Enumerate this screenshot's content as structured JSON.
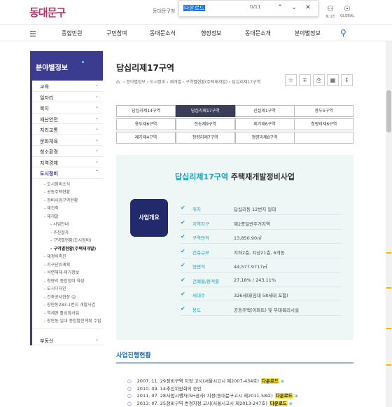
{
  "header": {
    "logo_text": "동대문구",
    "sub_text": "동대문구청",
    "login_label": "로그인",
    "global_label": "GLOBAL"
  },
  "find_bar": {
    "query": "다운로드",
    "count": "0/11"
  },
  "nav": {
    "items": [
      "종합민원",
      "구민참여",
      "동대문소식",
      "행정정보",
      "동대문소개",
      "분야별정보"
    ]
  },
  "sidebar": {
    "title": "분야별정보",
    "items": [
      {
        "label": "교육",
        "chev": "⌄"
      },
      {
        "label": "일자리",
        "chev": "⌄"
      },
      {
        "label": "복지",
        "chev": "⌄"
      },
      {
        "label": "재난안전",
        "chev": "⌄"
      },
      {
        "label": "지리교통",
        "chev": "⌄"
      },
      {
        "label": "문화체육",
        "chev": "⌄"
      },
      {
        "label": "청소환경",
        "chev": "⌄"
      },
      {
        "label": "지역경제",
        "chev": "⌄"
      },
      {
        "label": "도시정비",
        "chev": "⌃"
      }
    ],
    "sub_items": [
      {
        "label": "- 도시정비소식",
        "kind": ""
      },
      {
        "label": "- 공동주택현황",
        "kind": ""
      },
      {
        "label": "- 정비사업구역현황",
        "kind": ""
      },
      {
        "label": "- 재건축",
        "kind": ""
      },
      {
        "label": "- 재개발",
        "kind": ""
      },
      {
        "label": "- 사업안내",
        "kind": "deep"
      },
      {
        "label": "- 추진절차",
        "kind": "deep"
      },
      {
        "label": "- 구역별현황(도시정비)",
        "kind": "deep"
      },
      {
        "label": "- 구역별현황(주택재개발)",
        "kind": "deep cur"
      },
      {
        "label": "- 재정비촉진",
        "kind": ""
      },
      {
        "label": "- 지구단위계획",
        "kind": ""
      },
      {
        "label": "- 석면해체·제거정보",
        "kind": ""
      },
      {
        "label": "- 청량리 종합정비 육성",
        "kind": ""
      },
      {
        "label": "- 도시디자인",
        "kind": ""
      },
      {
        "label": "- 건축공사현장 ☺",
        "kind": ""
      },
      {
        "label": "- 장안동283-1번지 개발사업",
        "kind": ""
      },
      {
        "label": "- 역세권 활성화사업",
        "kind": ""
      },
      {
        "label": "- 장안동 일대 종합발전계획 수립",
        "kind": ""
      }
    ],
    "bottom_item": {
      "label": "부동산",
      "chev": "⌄"
    }
  },
  "page": {
    "title": "답십리제17구역",
    "breadcrumb": [
      "분야별정보",
      "도시정비",
      "재개발",
      "구역별현황(주택재개발)",
      "답십리제17구역"
    ]
  },
  "tabs": [
    {
      "label": "답십리제14구역",
      "active": false
    },
    {
      "label": "답십리제17구역",
      "active": true
    },
    {
      "label": "신설제1구역",
      "active": false
    },
    {
      "label": "용두5구역",
      "active": false
    },
    {
      "label": "용두제6구역",
      "active": false
    },
    {
      "label": "전농제9구역",
      "active": false
    },
    {
      "label": "제기제6구역",
      "active": false
    },
    {
      "label": "청량리제6구역",
      "active": false
    },
    {
      "label": "제기제4구역",
      "active": false
    },
    {
      "label": "청량리제7구역",
      "active": false
    },
    {
      "label": "청량리제8구역",
      "active": false
    },
    {
      "label": "",
      "active": false
    }
  ],
  "info": {
    "title_highlight": "답십리제17구역",
    "title_rest": " 주택재개발정비사업",
    "badge": "사업개요",
    "rows": [
      {
        "label": "위치",
        "value": "답십리동 12번지 일대"
      },
      {
        "label": "지역지구",
        "value": "제2종일반주거지역"
      },
      {
        "label": "구역면적",
        "value": "13,850.90㎡"
      },
      {
        "label": "건축규모",
        "value": "지하2층, 지상21층, 6개동"
      },
      {
        "label": "연면적",
        "value": "44,577.9717㎡"
      },
      {
        "label": "건폐율/용적률",
        "value": "27.18% / 243.11%"
      },
      {
        "label": "세대수",
        "value": "326세대(임대 58세대 포함)"
      },
      {
        "label": "용도",
        "value": "공동주택(아파트) 및 부대복리시설"
      }
    ]
  },
  "history": {
    "title": "사업진행현황",
    "download_label": "다운로드",
    "rows": [
      {
        "date": "2007. 11. 29.",
        "text": "정비구역 지정 고시(서울시고시 제2007-434호)",
        "dl": true
      },
      {
        "date": "2010. 09. 14.",
        "text": "추진위원회의 승인",
        "dl": false
      },
      {
        "date": "2011. 07. 28.",
        "text": "사업시행자(SH공사) 지정(동대문구고시 제2011-58호)",
        "dl": true
      },
      {
        "date": "2013. 07. 25.",
        "text": "정비구역 변경지정 고시(서울시고시 제2013-247호)",
        "dl": true
      }
    ]
  }
}
